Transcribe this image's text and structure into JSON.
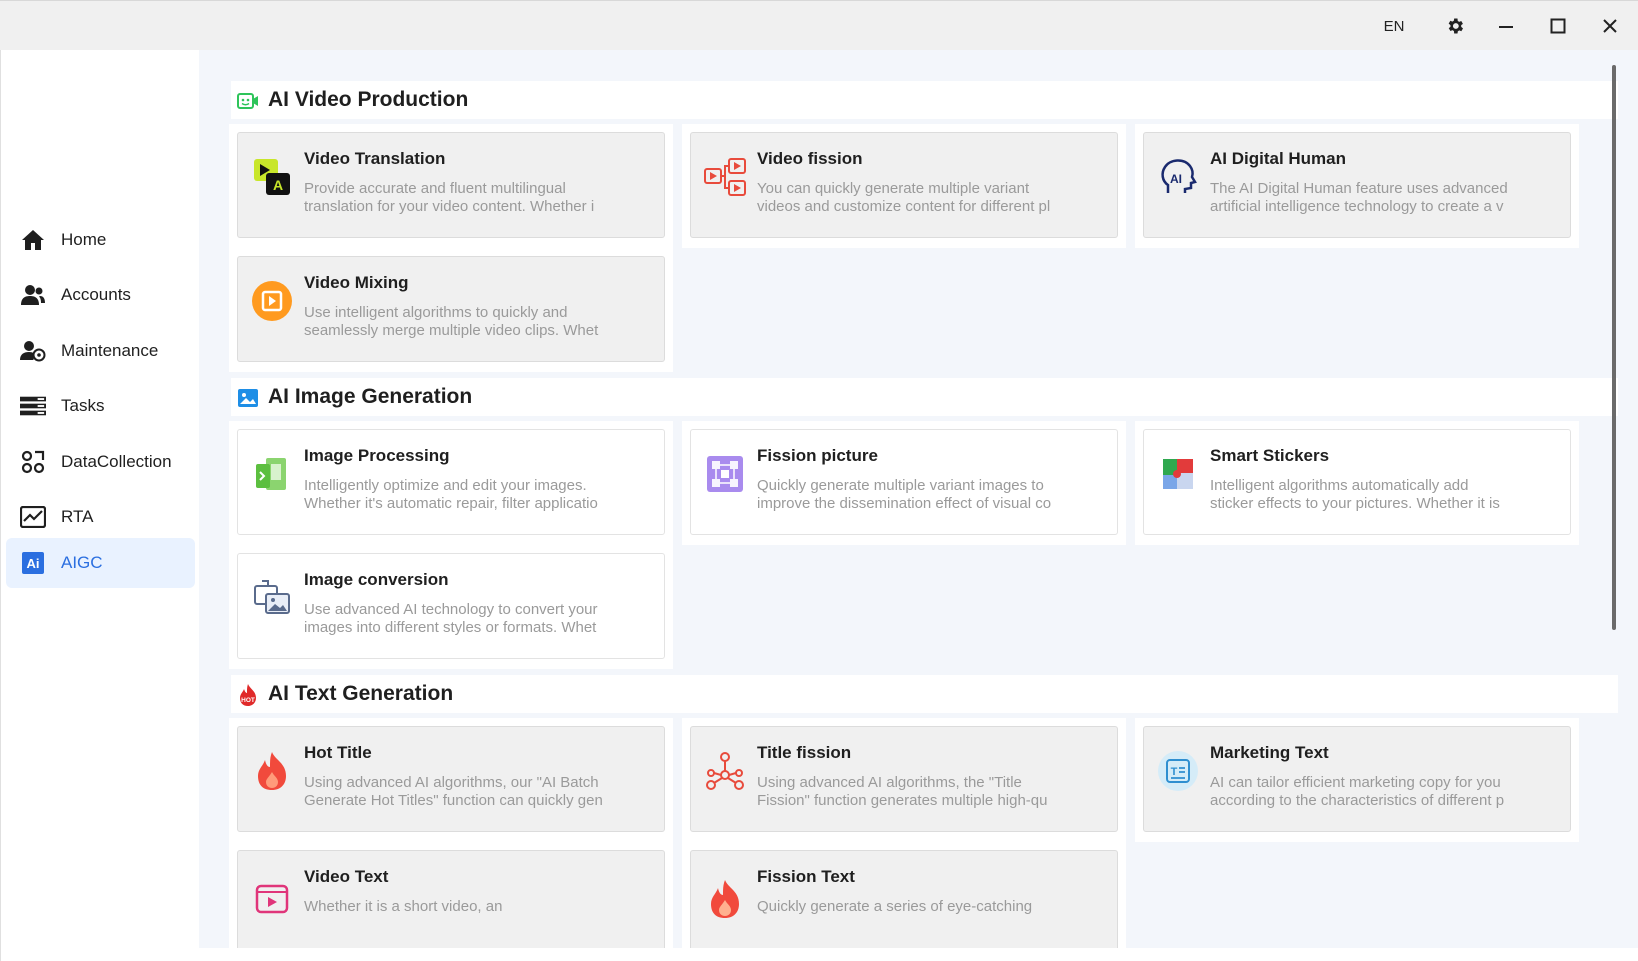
{
  "titlebar": {
    "language": "EN",
    "icons": {
      "settings": "gear-icon",
      "minimize": "minimize-icon",
      "maximize": "maximize-icon",
      "close": "close-icon"
    }
  },
  "sidebar": {
    "items": [
      {
        "label": "Home",
        "icon": "home-icon"
      },
      {
        "label": "Accounts",
        "icon": "users-icon"
      },
      {
        "label": "Maintenance",
        "icon": "user-gear-icon"
      },
      {
        "label": "Tasks",
        "icon": "tasks-icon"
      },
      {
        "label": "DataCollection",
        "icon": "data-collection-icon"
      },
      {
        "label": "RTA",
        "icon": "chart-icon"
      },
      {
        "label": "AIGC",
        "icon": "ai-icon",
        "active": true
      }
    ]
  },
  "sections": [
    {
      "title": "AI Video Production",
      "icon": "video-camera-icon",
      "cards": [
        {
          "title": "Video Translation",
          "desc1": "Provide accurate and fluent multilingual",
          "desc2": "translation for your video content. Whether i",
          "icon": "video-translation-icon"
        },
        {
          "title": "Video fission",
          "desc1": "You can quickly generate multiple variant",
          "desc2": "videos and customize content for different pl",
          "icon": "video-fission-icon"
        },
        {
          "title": "AI Digital Human",
          "desc1": "The AI Digital Human feature uses advanced",
          "desc2": "artificial intelligence technology to create a v",
          "icon": "digital-human-icon"
        },
        {
          "title": "Video Mixing",
          "desc1": "Use intelligent algorithms to quickly and",
          "desc2": "seamlessly merge multiple video clips. Whet",
          "icon": "video-mixing-icon"
        }
      ]
    },
    {
      "title": "AI Image Generation",
      "icon": "image-icon",
      "cards": [
        {
          "title": "Image Processing",
          "desc1": "Intelligently optimize and edit your images.",
          "desc2": "Whether it's automatic repair, filter applicatio",
          "icon": "image-processing-icon"
        },
        {
          "title": "Fission picture",
          "desc1": "Quickly generate multiple variant images to",
          "desc2": "improve the dissemination effect of visual co",
          "icon": "fission-picture-icon"
        },
        {
          "title": "Smart Stickers",
          "desc1": "Intelligent algorithms automatically add",
          "desc2": "sticker effects to your pictures. Whether it is",
          "icon": "smart-stickers-icon"
        },
        {
          "title": "Image conversion",
          "desc1": "Use advanced AI technology to convert your",
          "desc2": "images into different styles or formats. Whet",
          "icon": "image-conversion-icon"
        }
      ]
    },
    {
      "title": "AI Text Generation",
      "icon": "hot-fire-icon",
      "cards": [
        {
          "title": "Hot Title",
          "desc1": "Using advanced AI algorithms, our \"AI Batch",
          "desc2": "Generate Hot Titles\" function can quickly gen",
          "icon": "flame-icon"
        },
        {
          "title": "Title fission",
          "desc1": "Using advanced AI algorithms, the \"Title",
          "desc2": "Fission\" function generates multiple high-qu",
          "icon": "network-icon"
        },
        {
          "title": "Marketing Text",
          "desc1": "AI can tailor efficient marketing copy for you",
          "desc2": "according to the characteristics of different p",
          "icon": "text-document-icon"
        },
        {
          "title": "Video Text",
          "desc1": "Whether it is a short video, an",
          "desc2": "",
          "icon": "video-text-icon"
        },
        {
          "title": "Fission Text",
          "desc1": "Quickly generate a series of eye-catching",
          "desc2": "",
          "icon": "fission-text-flame-icon"
        }
      ]
    }
  ],
  "colors": {
    "accent": "#2b6fe0",
    "active_bg": "#e9f2ff",
    "content_bg": "#f3f6fb"
  }
}
